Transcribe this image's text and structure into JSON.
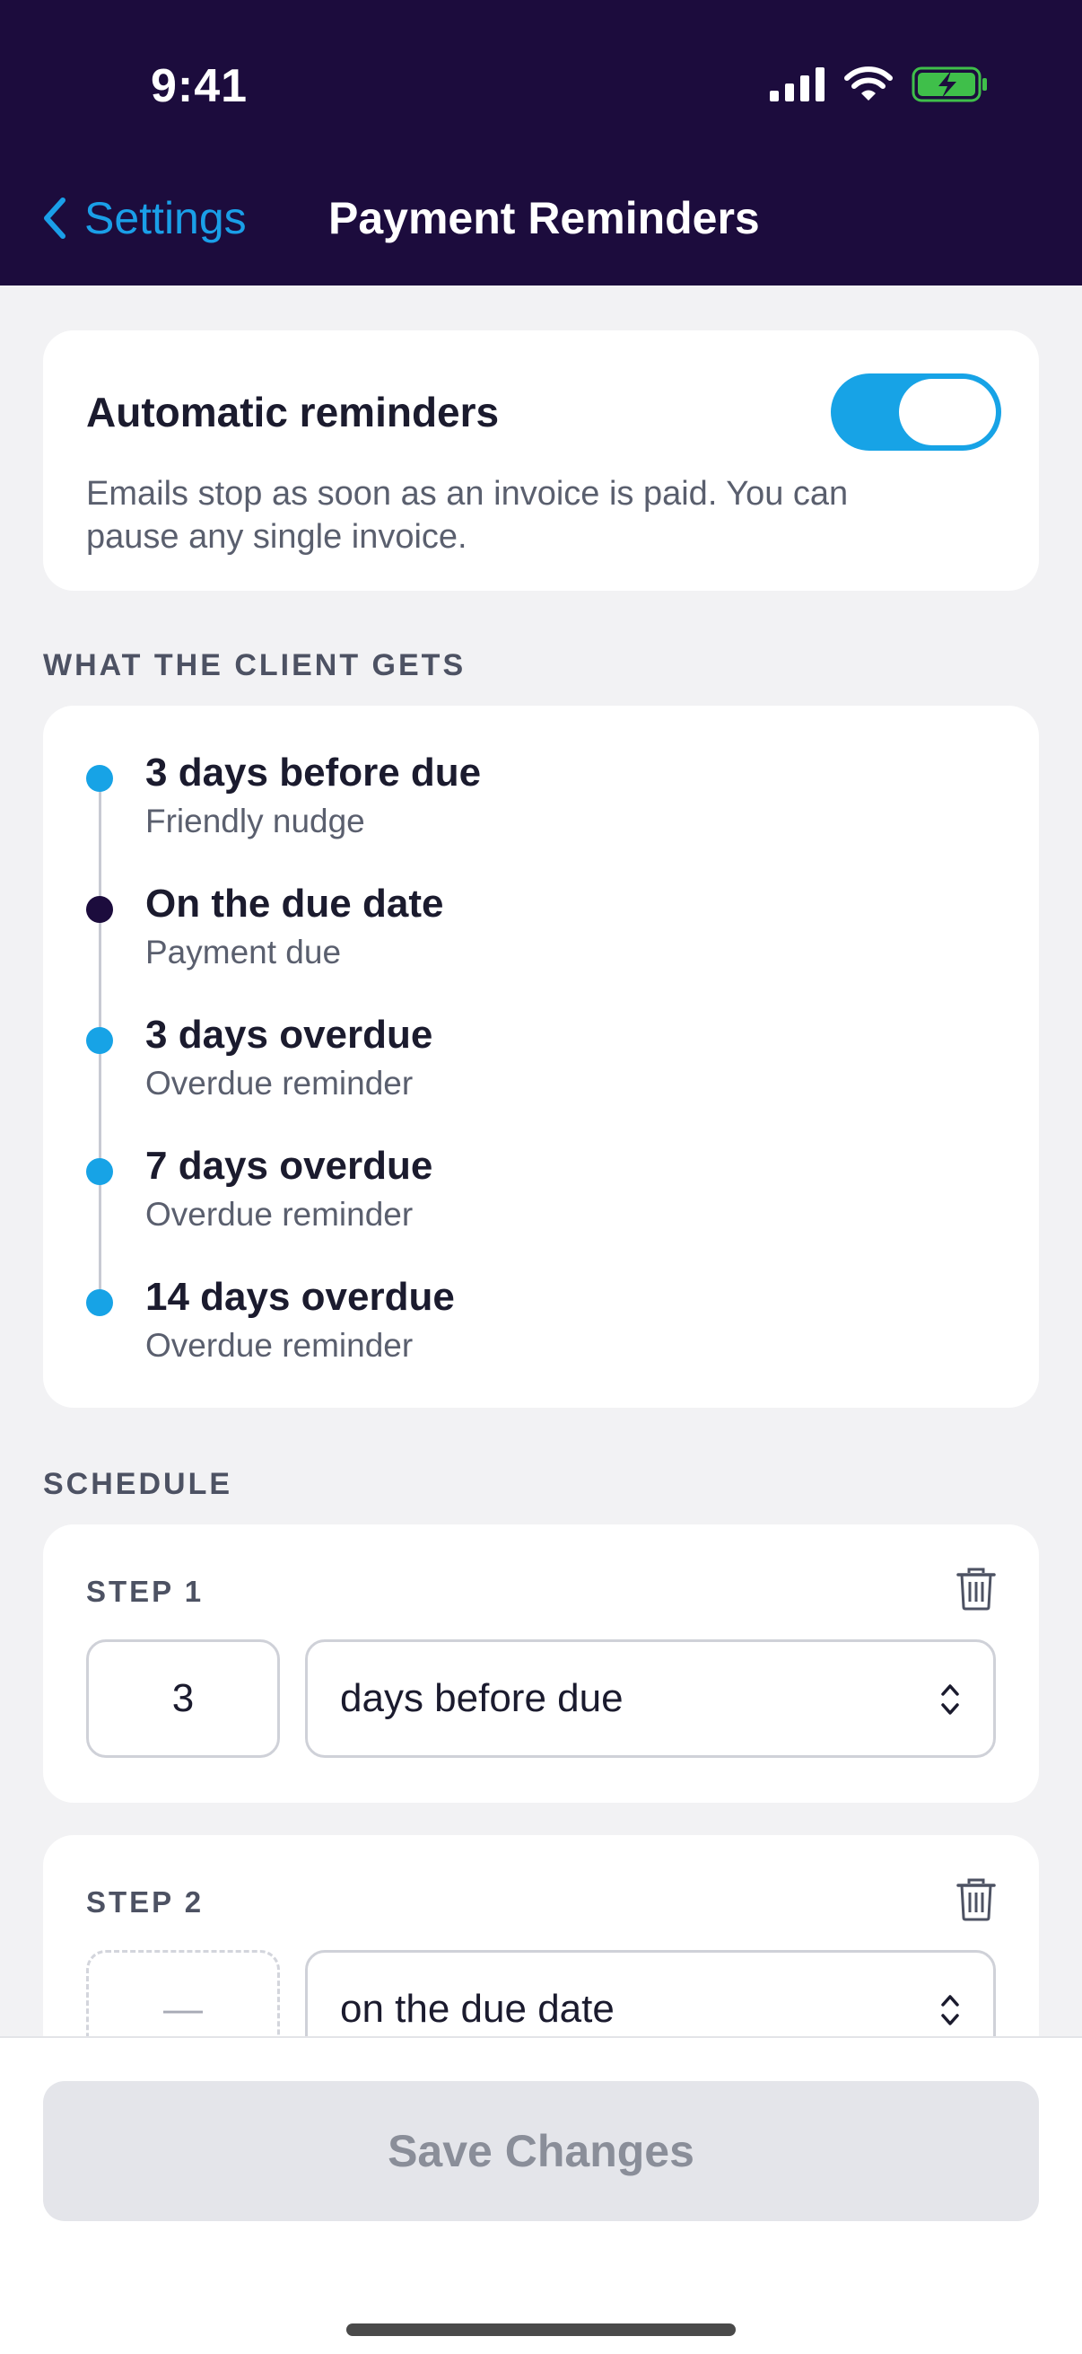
{
  "status_bar": {
    "time": "9:41"
  },
  "nav": {
    "back_label": "Settings",
    "title": "Payment Reminders"
  },
  "automatic": {
    "title": "Automatic reminders",
    "description": "Emails stop as soon as an invoice is paid. You can pause any single invoice.",
    "enabled": true
  },
  "client_section": {
    "label": "WHAT THE CLIENT GETS",
    "items": [
      {
        "title": "3 days before due",
        "subtitle": "Friendly nudge"
      },
      {
        "title": "On the due date",
        "subtitle": "Payment due"
      },
      {
        "title": "3 days overdue",
        "subtitle": "Overdue reminder"
      },
      {
        "title": "7 days overdue",
        "subtitle": "Overdue reminder"
      },
      {
        "title": "14 days overdue",
        "subtitle": "Overdue reminder"
      }
    ]
  },
  "schedule": {
    "label": "SCHEDULE",
    "steps": [
      {
        "label": "STEP 1",
        "days": "3",
        "timing": "days before due"
      },
      {
        "label": "STEP 2",
        "days": "—",
        "timing": "on the due date"
      }
    ]
  },
  "footer": {
    "save_label": "Save Changes"
  },
  "colors": {
    "header": "#1c0c3d",
    "accent": "#17a3e6",
    "background": "#f2f2f4"
  }
}
